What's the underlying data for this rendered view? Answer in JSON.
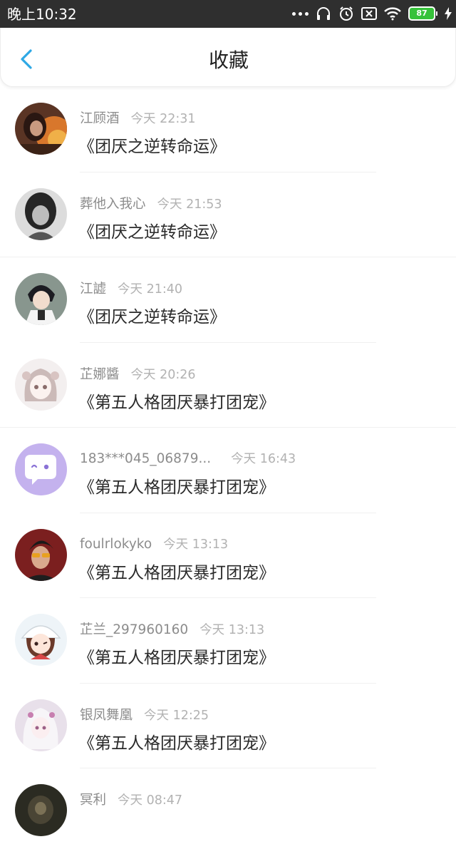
{
  "status_bar": {
    "time": "晚上10:32",
    "battery": "87"
  },
  "header": {
    "title": "收藏"
  },
  "colors": {
    "accent": "#2ea8e5",
    "status_bar": "#2f2f2f",
    "battery": "#36c23a"
  },
  "items": [
    {
      "username": "江顾酒",
      "time": "今天 22:31",
      "title": "《团厌之逆转命运》",
      "avatar": "avatar-fire"
    },
    {
      "username": "葬他入我心",
      "time": "今天 21:53",
      "title": "《团厌之逆转命运》",
      "avatar": "avatar-grey-girl"
    },
    {
      "username": "江譃",
      "time": "今天 21:40",
      "title": "《团厌之逆转命运》",
      "avatar": "avatar-anime-boy"
    },
    {
      "username": "芷娜醬",
      "time": "今天 20:26",
      "title": "《第五人格团厌暴打团宠》",
      "avatar": "avatar-sketch-girl"
    },
    {
      "username": "183***045_06879...",
      "time": "今天 16:43",
      "title": "《第五人格团厌暴打团宠》",
      "avatar": "avatar-chat-bubble"
    },
    {
      "username": "foulrlokyko",
      "time": "今天 13:13",
      "title": "《第五人格团厌暴打团宠》",
      "avatar": "avatar-sunglasses-man"
    },
    {
      "username": "芷兰_297960160",
      "time": "今天 13:13",
      "title": "《第五人格团厌暴打团宠》",
      "avatar": "avatar-cartoon-girl"
    },
    {
      "username": "银凤舞凰",
      "time": "今天 12:25",
      "title": "《第五人格团厌暴打团宠》",
      "avatar": "avatar-white-hair-girl"
    },
    {
      "username": "冥利",
      "time": "今天 08:47",
      "title": "",
      "avatar": "avatar-dark"
    }
  ]
}
